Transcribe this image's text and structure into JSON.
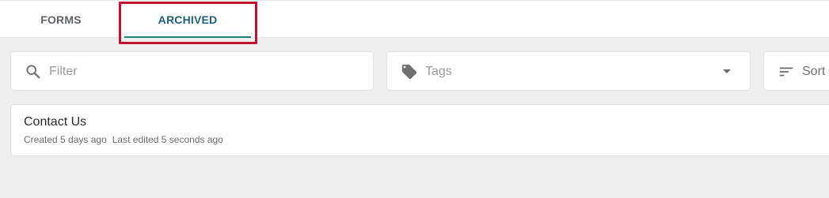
{
  "tabs": [
    {
      "label": "FORMS",
      "active": false
    },
    {
      "label": "ARCHIVED",
      "active": true
    }
  ],
  "colors": {
    "active_tab_text": "#1d6079",
    "active_underline": "#1b7f7a",
    "highlight_border": "#c4102f",
    "page_background": "#eeeeee"
  },
  "filters": {
    "search": {
      "placeholder": "Filter",
      "icon": "search-icon"
    },
    "tags": {
      "placeholder": "Tags",
      "icon": "tag-icon",
      "dropdown_icon": "caret-down-icon"
    },
    "sort": {
      "label": "Sort",
      "icon": "sort-icon"
    }
  },
  "forms": [
    {
      "title": "Contact Us",
      "created": "Created 5 days ago",
      "edited": "Last edited 5 seconds ago"
    }
  ]
}
